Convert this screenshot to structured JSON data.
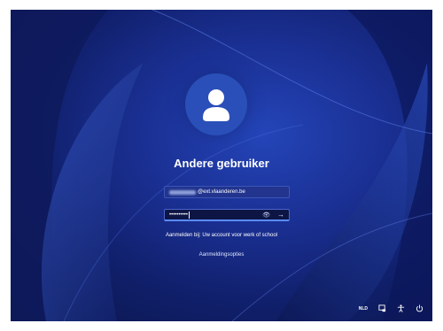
{
  "user": {
    "display_name": "Andere gebruiker",
    "email_domain": "@ext.vlaanderen.be"
  },
  "password": {
    "masked_value": "••••••••••"
  },
  "signin_hint": "Aanmelden bij: Uw account voor werk of school",
  "sign_in_options_label": "Aanmeldingsopties",
  "tray": {
    "language": "NLD",
    "icons": [
      "network-icon",
      "accessibility-icon",
      "power-icon"
    ]
  },
  "colors": {
    "background": "#1a2f92",
    "avatar_circle": "#2a4fb8",
    "field_bg": "#22348d",
    "focus_accent": "#5b8cff"
  }
}
